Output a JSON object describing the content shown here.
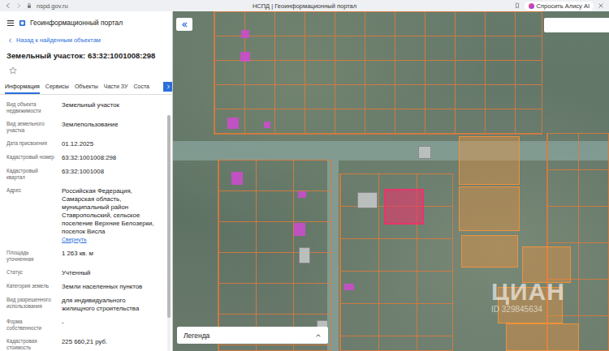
{
  "browser": {
    "address": "nspd.gov.ru",
    "title": "НСПД | Геоинформационный портал",
    "assistant_button": "Спросить Алису AI"
  },
  "sidebar": {
    "app_title": "Геоинформационный портал",
    "back_link": "Назад к найденным объектам",
    "object_title": "Земельный участок: 63:32:1001008:298",
    "favorite": false,
    "tabs": [
      {
        "label": "Информация",
        "selected": true
      },
      {
        "label": "Сервисы",
        "selected": false
      },
      {
        "label": "Объекты",
        "selected": false
      },
      {
        "label": "Части ЗУ",
        "selected": false
      },
      {
        "label": "Соста",
        "selected": false
      }
    ],
    "fields": [
      {
        "label": "Вид объекта недвижимости",
        "value": "Земельный участок"
      },
      {
        "label": "Вид земельного участка",
        "value": "Землепользование"
      },
      {
        "label": "Дата присвоения",
        "value": "01.12.2025"
      },
      {
        "label": "Кадастровый номер",
        "value": "63:32:1001008:298"
      },
      {
        "label": "Кадастровый квартал",
        "value": "63:32:1001008"
      },
      {
        "label": "Адрес",
        "value": "Российская Федерация, Самарская область, муниципальный район Ставропольский, сельское поселение Верхние Белозерки, поселок Висла",
        "link": "Свернуть"
      },
      {
        "label": "Площадь уточненная",
        "value": "1 263 кв. м"
      },
      {
        "label": "Статус",
        "value": "Учтенный"
      },
      {
        "label": "Категория земель",
        "value": "Земли населенных пунктов"
      },
      {
        "label": "Вид разрешенного использования",
        "value": "для индивидуального жилищного строительства"
      },
      {
        "label": "Форма собственности",
        "value": "-"
      },
      {
        "label": "Кадастровая стоимость",
        "value": "225 660,21 руб."
      }
    ]
  },
  "map": {
    "legend": "Легенда",
    "watermark": {
      "brand": "ЦИАН",
      "id": "ID 329845634"
    },
    "parcels": [
      {
        "selected": true,
        "color": "#e8356b"
      },
      {
        "selected": false,
        "color": "#f0913a"
      },
      {
        "selected": false,
        "color": "#f0913a"
      },
      {
        "selected": false,
        "color": "#f0913a"
      },
      {
        "selected": false,
        "color": "#f0913a"
      },
      {
        "selected": false,
        "color": "#f0913a"
      },
      {
        "selected": false,
        "color": "#f0913a"
      }
    ]
  }
}
